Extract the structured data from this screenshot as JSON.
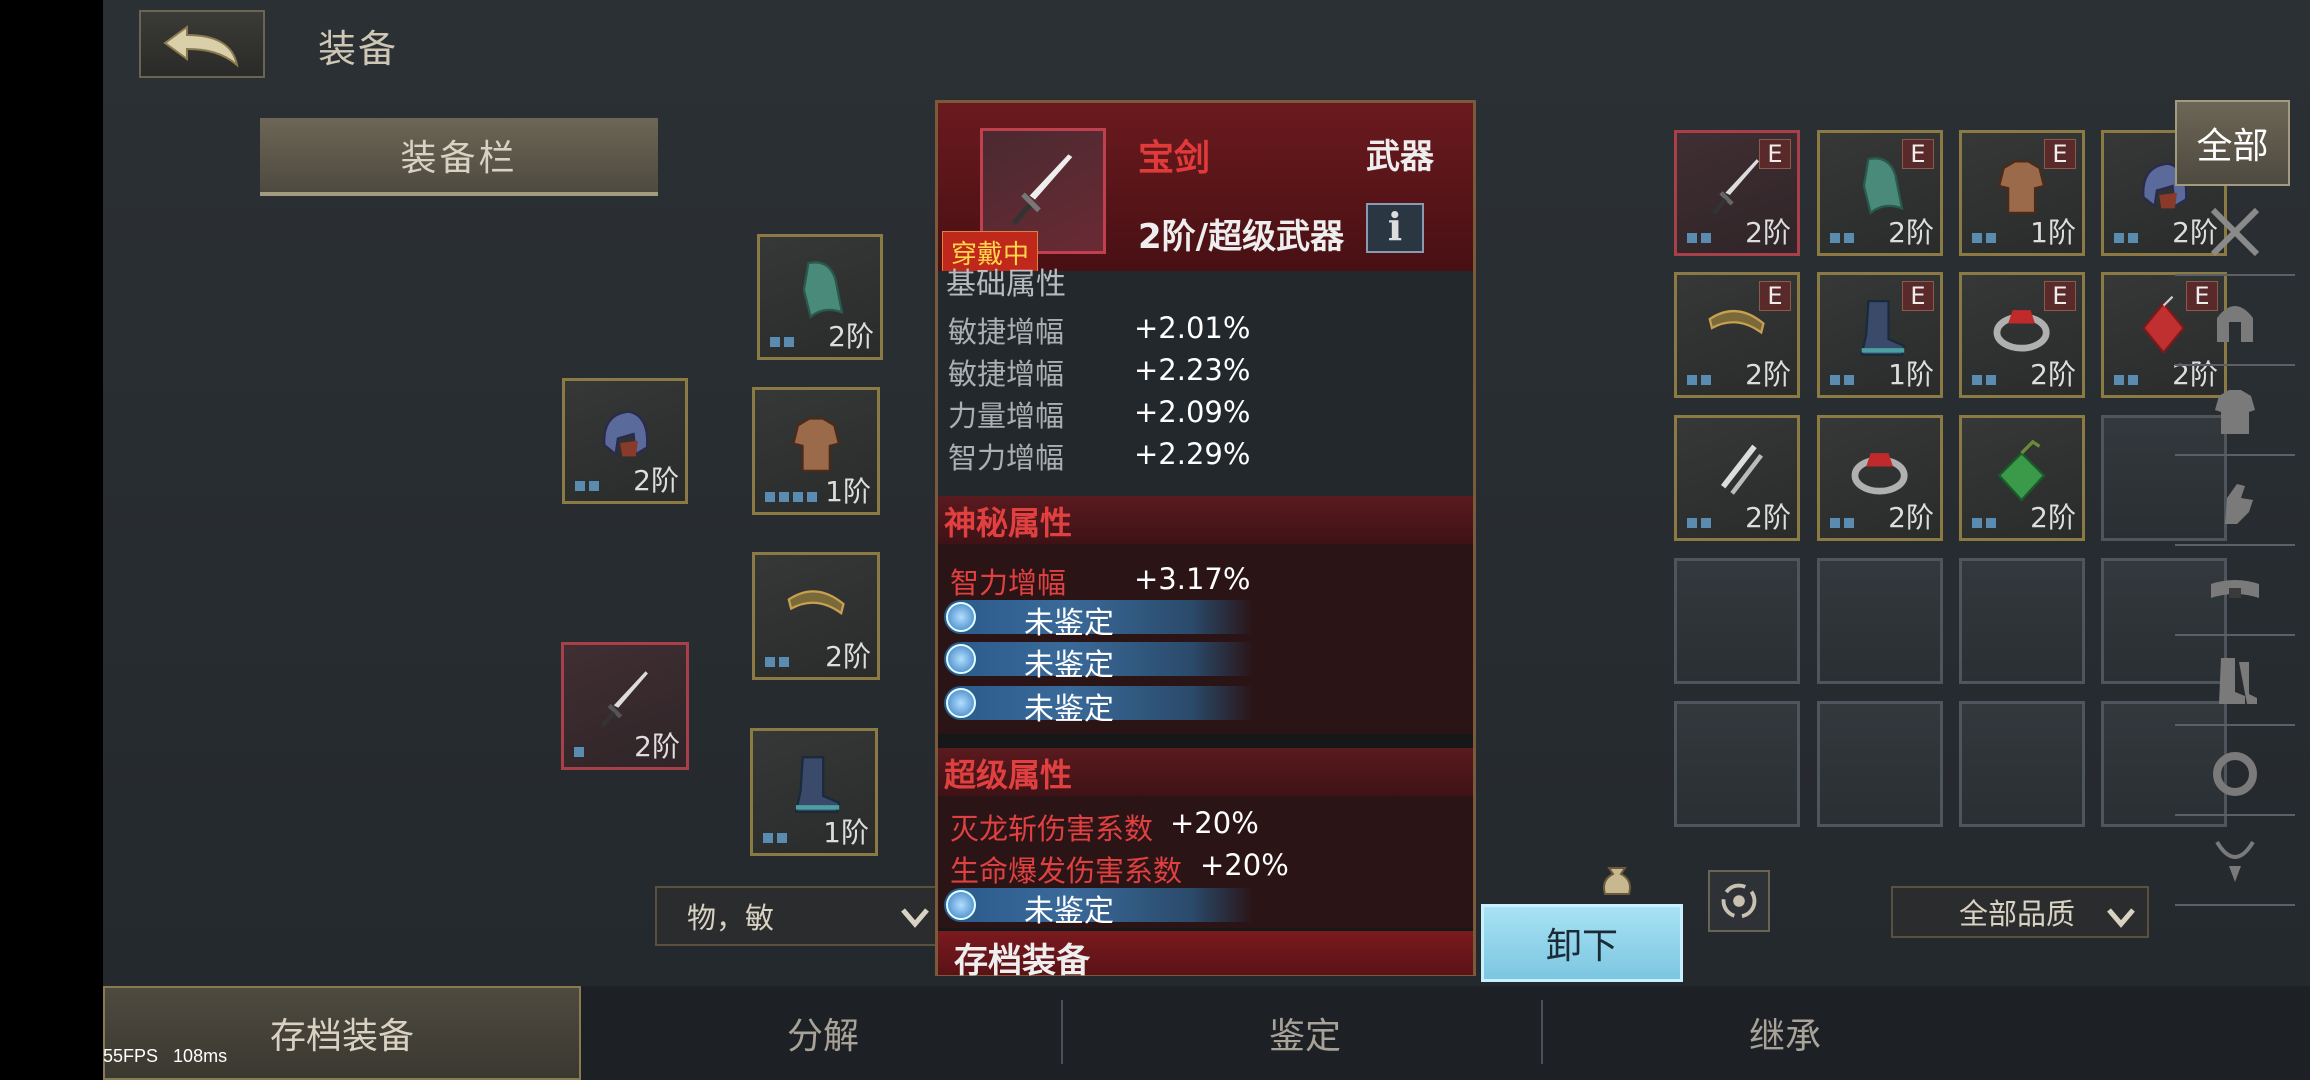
{
  "header": {
    "title": "装备"
  },
  "tab": {
    "label": "装备栏"
  },
  "equipped_slots": [
    {
      "name": "equipped-cloak",
      "level": "2阶"
    },
    {
      "name": "equipped-helmet",
      "level": "2阶"
    },
    {
      "name": "equipped-armor",
      "level": "1阶"
    },
    {
      "name": "equipped-bracelet",
      "level": "2阶"
    },
    {
      "name": "equipped-sword",
      "level": "2阶"
    },
    {
      "name": "equipped-boots",
      "level": "1阶"
    }
  ],
  "popup": {
    "item_name": "宝剑",
    "item_type": "武器",
    "item_rank": "2阶/超级武器",
    "wearing_badge": "穿戴中",
    "info_label": "i",
    "base_title": "基础属性",
    "base_attrs": [
      {
        "name": "敏捷增幅",
        "value": "+2.01%"
      },
      {
        "name": "敏捷增幅",
        "value": "+2.23%"
      },
      {
        "name": "力量增幅",
        "value": "+2.09%"
      },
      {
        "name": "智力增幅",
        "value": "+2.29%"
      }
    ],
    "mystic_title": "神秘属性",
    "mystic_attr": {
      "name": "智力增幅",
      "value": "+3.17%"
    },
    "unidentified": "未鉴定",
    "super_title": "超级属性",
    "super_attrs": [
      {
        "name": "灭龙斩伤害系数",
        "value": "+20%"
      },
      {
        "name": "生命爆发伤害系数",
        "value": "+20%"
      }
    ],
    "footer": "存档装备"
  },
  "unequip_button": "卸下",
  "filter_left": "物，敏",
  "filter_right": "全部品质",
  "inventory": [
    {
      "level": "2阶",
      "badge": "E",
      "art": "sword",
      "selected": true
    },
    {
      "level": "2阶",
      "badge": "E",
      "art": "cloak"
    },
    {
      "level": "1阶",
      "badge": "E",
      "art": "armor"
    },
    {
      "level": "2阶",
      "badge": "E",
      "art": "helmet"
    },
    {
      "level": "2阶",
      "badge": "E",
      "art": "bracelet"
    },
    {
      "level": "1阶",
      "badge": "E",
      "art": "boots"
    },
    {
      "level": "2阶",
      "badge": "E",
      "art": "ring-red"
    },
    {
      "level": "2阶",
      "badge": "E",
      "art": "amulet-red"
    },
    {
      "level": "2阶",
      "badge": "",
      "art": "daggers"
    },
    {
      "level": "2阶",
      "badge": "",
      "art": "ring-red"
    },
    {
      "level": "2阶",
      "badge": "",
      "art": "amulet-green"
    }
  ],
  "categories": {
    "all": "全部",
    "icons": [
      "crossed-swords-icon",
      "helmet-icon",
      "armor-icon",
      "gauntlet-icon",
      "belt-icon",
      "boots-icon",
      "ring-icon",
      "necklace-icon"
    ]
  },
  "bottom_tabs": [
    "存档装备",
    "分解",
    "鉴定",
    "继承"
  ],
  "debug": {
    "fps": "55FPS",
    "ping": "108ms"
  },
  "colors": {
    "accent_red": "#e04040",
    "slot_gold": "#8c7a44",
    "slot_red": "#a8404a",
    "unequip_blue": "#8cd0e8"
  }
}
